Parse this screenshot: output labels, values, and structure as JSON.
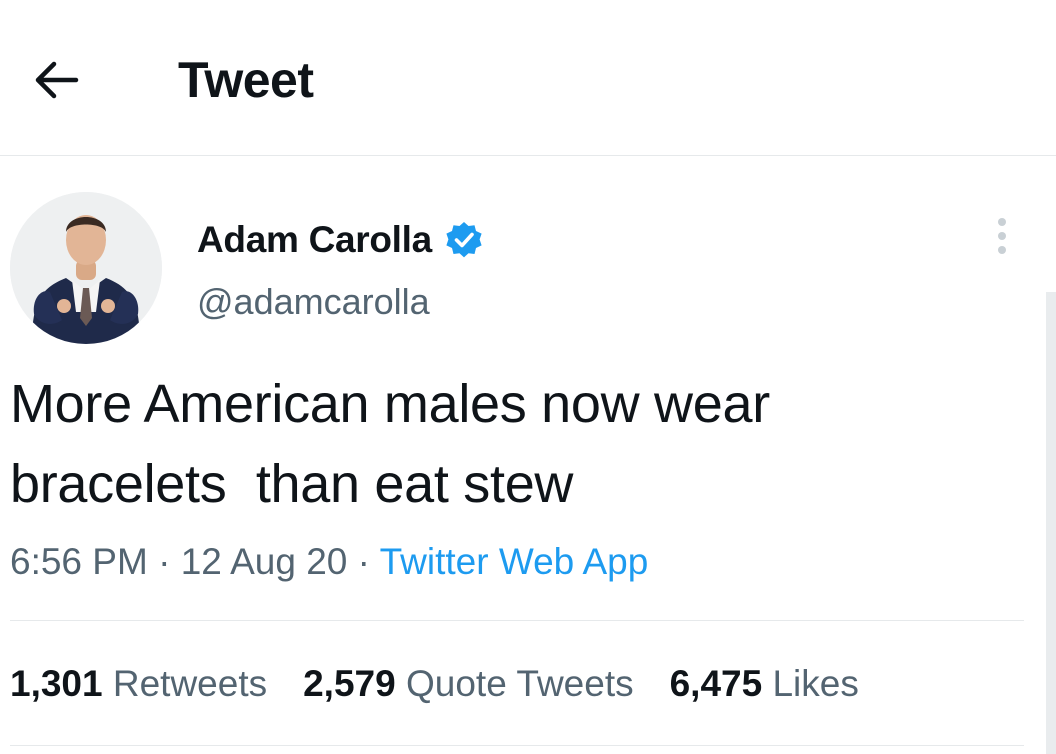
{
  "header": {
    "title": "Tweet",
    "back_icon": "arrow-left-icon"
  },
  "tweet": {
    "author": {
      "display_name": "Adam Carolla",
      "handle": "@adamcarolla",
      "verified": true,
      "verified_color": "#1d9bf0"
    },
    "text": "More American males now wear\nbracelets  than eat stew",
    "time": "6:56 PM",
    "separator": " · ",
    "date": "12 Aug 20",
    "source": "Twitter Web App",
    "more_icon": "more-vertical-icon"
  },
  "stats": [
    {
      "value": "1,301",
      "label": "Retweets"
    },
    {
      "value": "2,579",
      "label": "Quote Tweets"
    },
    {
      "value": "6,475",
      "label": "Likes"
    }
  ],
  "colors": {
    "text": "#0f1419",
    "secondary": "#536471",
    "accent": "#1d9bf0",
    "divider": "#e6e9eb"
  }
}
